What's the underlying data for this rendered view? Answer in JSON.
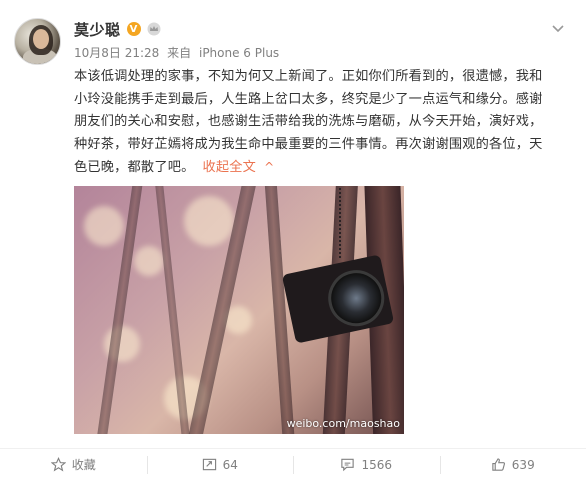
{
  "user": {
    "name": "莫少聪",
    "verified_badge": "V",
    "verified_color": "#f4a622"
  },
  "post": {
    "date": "10月8日 21:28",
    "source_prefix": "来自",
    "source": "iPhone 6 Plus",
    "lines": [
      "本该低调处理的家事，不知为何又上新闻了。正如你们所看到的，很遗憾，我和",
      "小玲没能携手走到最后，人生路上岔口太多，终究是少了一点运气和缘分。感谢",
      "朋友们的关心和安慰，也感谢生活带给我的洗炼与磨砺，从今天开始，演好戏，",
      "种好茶，带好芷嫣将成为我生命中最重要的三件事情。再次谢谢围观的各位，天",
      "色已晚，都散了吧。"
    ],
    "collapse_label": "收起全文",
    "collapse_arrow": "^",
    "collapse_color": "#eb7350",
    "photo_watermark": "weibo.com/maoshao"
  },
  "actions": {
    "favorite_label": "收藏",
    "repost_count": "64",
    "comment_count": "1566",
    "like_count": "639"
  },
  "icons": [
    "crown-icon",
    "chevron-down-icon",
    "star-icon",
    "repost-icon",
    "comment-icon",
    "like-icon"
  ]
}
